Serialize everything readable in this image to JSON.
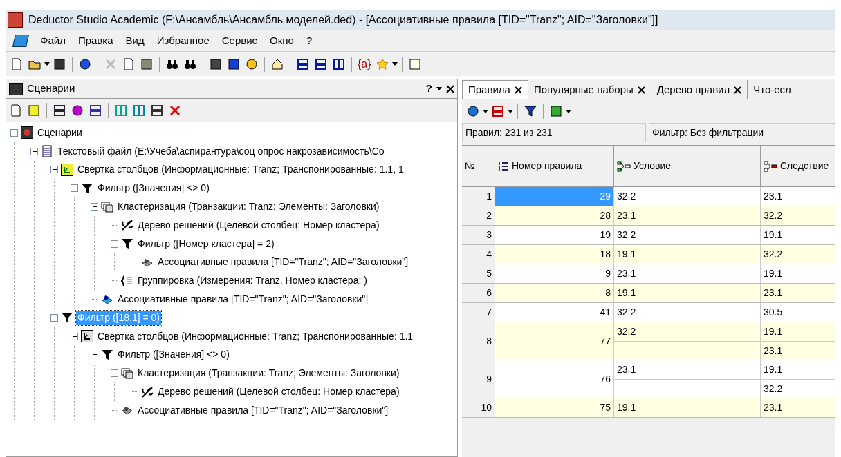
{
  "window": {
    "title": "Deductor Studio Academic (F:\\Ансамбль\\Ансамбль моделей.ded) - [Ассоциативные правила [TID=\"Tranz\"; AID=\"Заголовки\"]]"
  },
  "menu": [
    "Файл",
    "Правка",
    "Вид",
    "Избранное",
    "Сервис",
    "Окно",
    "?"
  ],
  "toolbar": {
    "variable_button": "{a}"
  },
  "scenarios_panel": {
    "title": "Сценарии",
    "help": "?",
    "tree": [
      {
        "label": "Сценарии",
        "kind": "root",
        "selected": false,
        "expanded": true,
        "children": [
          {
            "label": "Текстовый файл (E:\\Учеба\\аспирантура\\соц опрос накрозависимость\\Со",
            "kind": "text",
            "selected": false,
            "expanded": true,
            "children": [
              {
                "label": "Свёртка столбцов (Информационные: Tranz; Транспонированные: 1.1, 1",
                "kind": "fold",
                "selected": false,
                "expanded": true,
                "children": [
                  {
                    "label": "Фильтр ([Значения] <> 0)",
                    "kind": "filter",
                    "selected": false,
                    "expanded": true,
                    "children": [
                      {
                        "label": "Кластеризация (Транзакции: Tranz; Элементы: Заголовки)",
                        "kind": "cluster",
                        "selected": false,
                        "expanded": true,
                        "children": [
                          {
                            "label": "Дерево решений (Целевой столбец: Номер кластера)",
                            "kind": "tree",
                            "selected": false
                          },
                          {
                            "label": "Фильтр ([Номер кластера] = 2)",
                            "kind": "filter",
                            "selected": false,
                            "expanded": true,
                            "children": [
                              {
                                "label": "Ассоциативные правила [TID=\"Tranz\"; AID=\"Заголовки\"]",
                                "kind": "assoc",
                                "selected": false
                              }
                            ]
                          },
                          {
                            "label": "Группировка (Измерения: Tranz, Номер кластера; )",
                            "kind": "group",
                            "selected": false
                          }
                        ]
                      },
                      {
                        "label": "Ассоциативные правила [TID=\"Tranz\"; AID=\"Заголовки\"]",
                        "kind": "assoc_color",
                        "selected": false
                      }
                    ]
                  }
                ]
              },
              {
                "label": "Фильтр ([18.1] = 0)",
                "kind": "filter",
                "selected": true,
                "expanded": true,
                "children": [
                  {
                    "label": "Свёртка столбцов (Информационные: Tranz; Транспонированные: 1.1",
                    "kind": "fold_gray",
                    "selected": false,
                    "expanded": true,
                    "children": [
                      {
                        "label": "Фильтр ([Значения] <> 0)",
                        "kind": "filter",
                        "selected": false,
                        "expanded": true,
                        "children": [
                          {
                            "label": "Кластеризация (Транзакции: Tranz; Элементы: Заголовки)",
                            "kind": "cluster",
                            "selected": false,
                            "expanded": true,
                            "children": [
                              {
                                "label": "Дерево решений (Целевой столбец: Номер кластера)",
                                "kind": "tree",
                                "selected": false
                              }
                            ]
                          },
                          {
                            "label": "Ассоциативные правила [TID=\"Tranz\"; AID=\"Заголовки\"]",
                            "kind": "assoc",
                            "selected": false
                          }
                        ]
                      }
                    ]
                  }
                ]
              }
            ]
          }
        ]
      }
    ]
  },
  "tabs": [
    {
      "label": "Правила",
      "selected": true
    },
    {
      "label": "Популярные наборы",
      "selected": false
    },
    {
      "label": "Дерево правил",
      "selected": false
    },
    {
      "label": "Что-есл",
      "selected": false
    }
  ],
  "status": {
    "count": "Правил: 231 из 231",
    "filter": "Фильтр: Без фильтрации"
  },
  "table": {
    "columns": [
      "№",
      "Номер правила",
      "Условие",
      "Следствие"
    ],
    "rows": [
      {
        "index": "1",
        "rule": "29",
        "conditions": [
          "32.2"
        ],
        "consequences": [
          "23.1"
        ],
        "selected": true
      },
      {
        "index": "2",
        "rule": "28",
        "conditions": [
          "23.1"
        ],
        "consequences": [
          "32.2"
        ],
        "selected": false
      },
      {
        "index": "3",
        "rule": "19",
        "conditions": [
          "32.2"
        ],
        "consequences": [
          "19.1"
        ],
        "selected": false
      },
      {
        "index": "4",
        "rule": "18",
        "conditions": [
          "19.1"
        ],
        "consequences": [
          "32.2"
        ],
        "selected": false
      },
      {
        "index": "5",
        "rule": "9",
        "conditions": [
          "23.1"
        ],
        "consequences": [
          "19.1"
        ],
        "selected": false
      },
      {
        "index": "6",
        "rule": "8",
        "conditions": [
          "19.1"
        ],
        "consequences": [
          "23.1"
        ],
        "selected": false
      },
      {
        "index": "7",
        "rule": "41",
        "conditions": [
          "32.2"
        ],
        "consequences": [
          "30.5"
        ],
        "selected": false
      },
      {
        "index": "8",
        "rule": "77",
        "conditions": [
          "32.2"
        ],
        "consequences": [
          "19.1",
          "23.1"
        ],
        "selected": false
      },
      {
        "index": "9",
        "rule": "76",
        "conditions": [
          "23.1"
        ],
        "consequences": [
          "19.1",
          "32.2"
        ],
        "selected": false
      },
      {
        "index": "10",
        "rule": "75",
        "conditions": [
          "19.1"
        ],
        "consequences": [
          "23.1"
        ],
        "selected": false
      }
    ]
  }
}
